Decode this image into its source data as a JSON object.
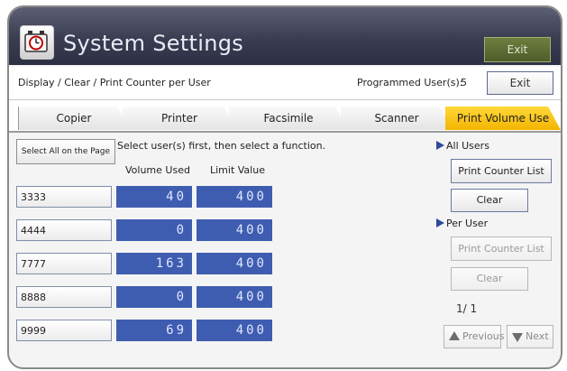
{
  "header": {
    "title": "System Settings",
    "exit_label": "Exit"
  },
  "subheader": {
    "breadcrumb": "Display / Clear / Print Counter per User",
    "programmed_users_label": "Programmed User(s):",
    "programmed_users_count": "5",
    "exit_label": "Exit"
  },
  "tabs": [
    {
      "label": "Copier"
    },
    {
      "label": "Printer"
    },
    {
      "label": "Facsimile"
    },
    {
      "label": "Scanner"
    },
    {
      "label": "Print Volume Use"
    }
  ],
  "left": {
    "select_all_label": "Select All on the Page",
    "instruction": "Select user(s) first, then select a function.",
    "col_volume": "Volume Used",
    "col_limit": "Limit Value",
    "rows": [
      {
        "user": "3333",
        "volume": "40",
        "limit": "400"
      },
      {
        "user": "4444",
        "volume": "0",
        "limit": "400"
      },
      {
        "user": "7777",
        "volume": "163",
        "limit": "400"
      },
      {
        "user": "8888",
        "volume": "0",
        "limit": "400"
      },
      {
        "user": "9999",
        "volume": "69",
        "limit": "400"
      }
    ]
  },
  "right": {
    "all_users_label": "All Users",
    "print_counter_list_label": "Print Counter List",
    "clear_label": "Clear",
    "per_user_label": "Per User",
    "per_user_print_counter_list_label": "Print Counter List",
    "per_user_clear_label": "Clear",
    "page_info": "1/  1",
    "previous_label": "Previous",
    "next_label": "Next"
  },
  "colors": {
    "title_bar": "#3a3d52",
    "active_tab": "#f3b400",
    "value_cell": "#3f5db0",
    "exit_top": "#4e5c2a"
  },
  "icons": {
    "title": "counter-icon"
  }
}
